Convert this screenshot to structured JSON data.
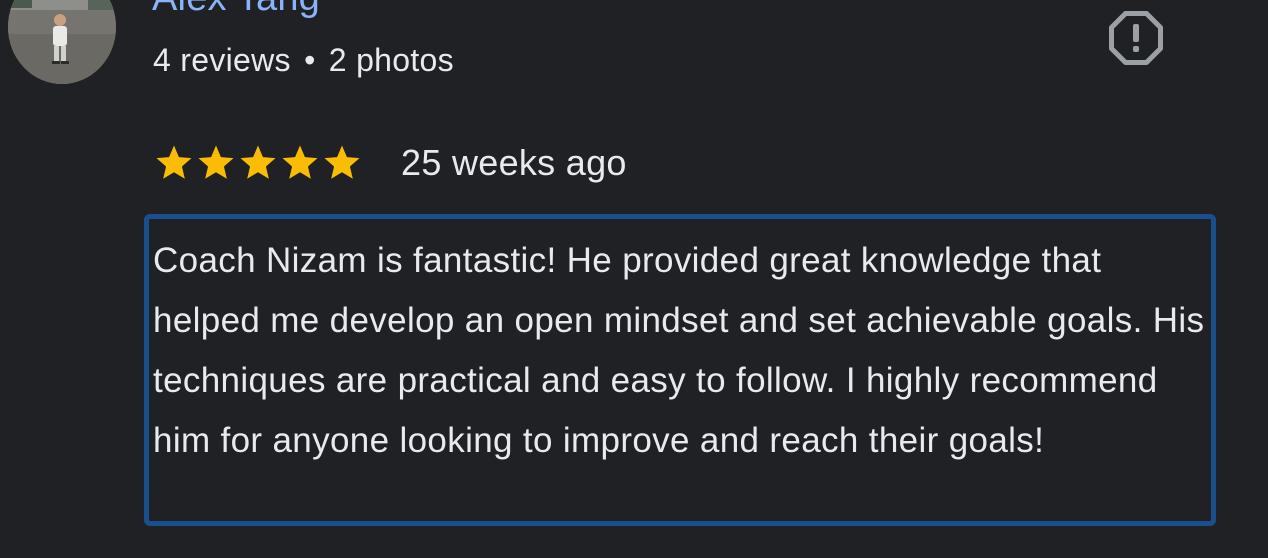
{
  "reviewer": {
    "name": "Alex Tang",
    "reviews_count": "4 reviews",
    "separator": "•",
    "photos_count": "2 photos"
  },
  "icons": {
    "avatar": "user-avatar-photo",
    "report": "report-icon",
    "star": "star-icon"
  },
  "review": {
    "rating": 5,
    "rating_max": 5,
    "date": "25 weeks ago",
    "text": "Coach Nizam is fantastic! He provided great knowledge that helped me develop an open mindset and set achievable goals. His techniques are practical and easy to follow. I highly recommend him for anyone looking to improve and reach their goals!"
  },
  "colors": {
    "background": "#202124",
    "name": "#8ab4f8",
    "text": "#e8eaed",
    "star": "#fbbc04",
    "report_icon": "#9aa0a6",
    "highlight_border": "#1a4f8e"
  }
}
